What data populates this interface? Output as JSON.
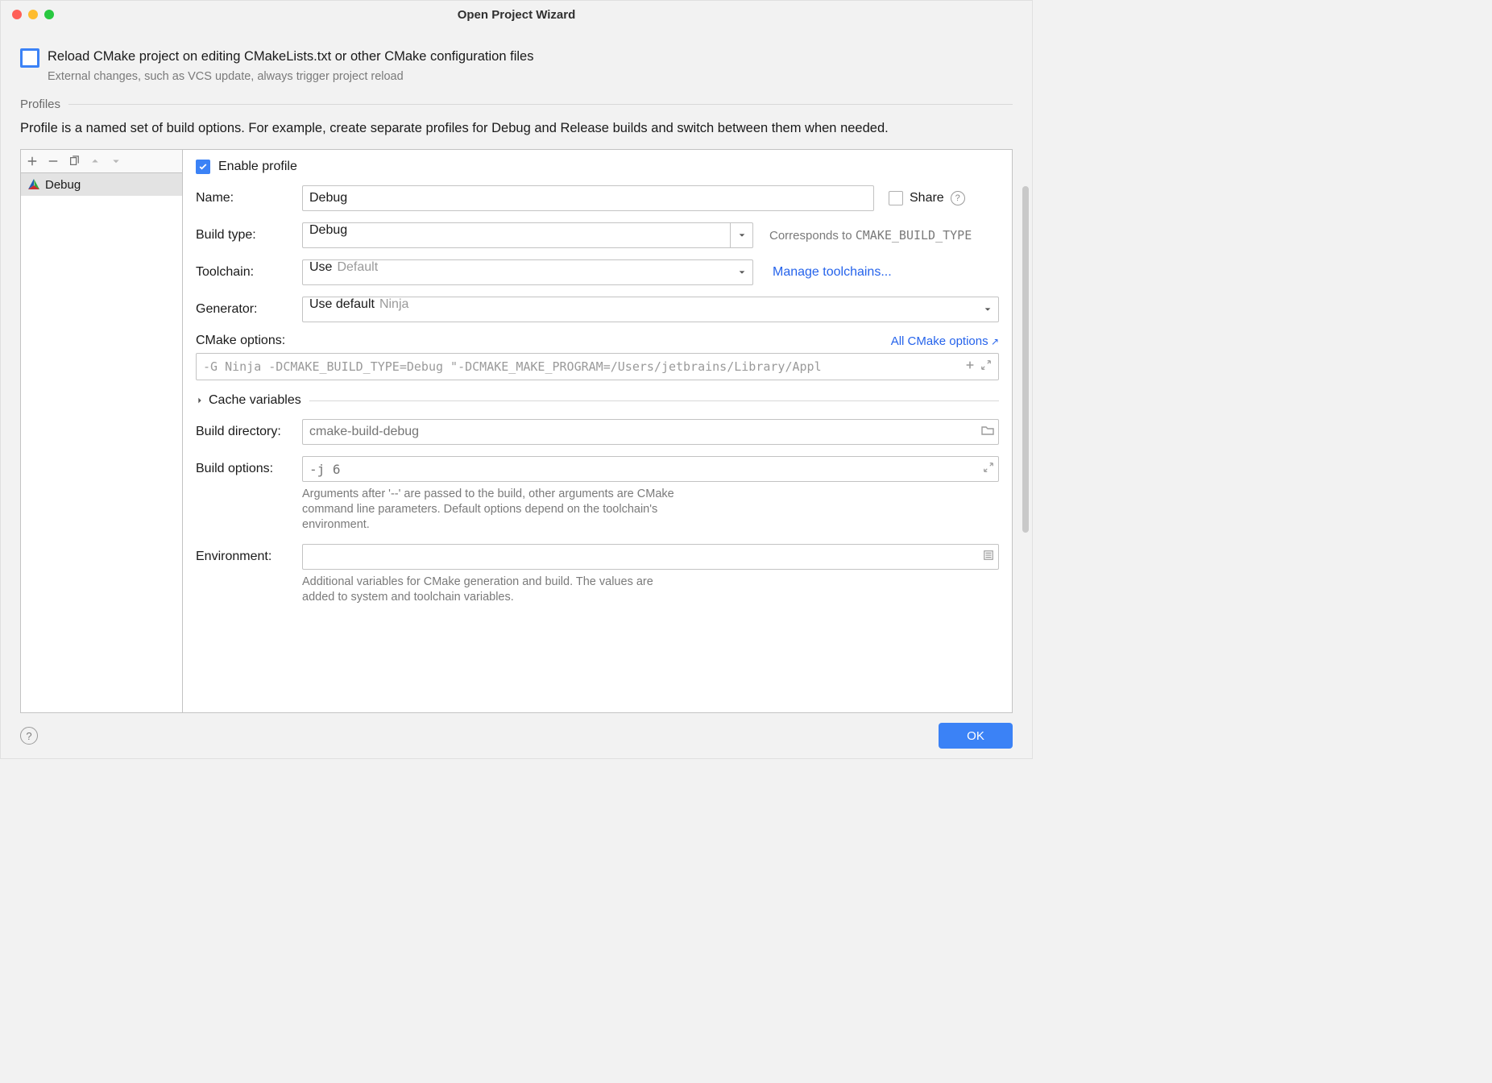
{
  "window": {
    "title": "Open Project Wizard"
  },
  "reload": {
    "label": "Reload CMake project on editing CMakeLists.txt or other CMake configuration files",
    "hint": "External changes, such as VCS update, always trigger project reload"
  },
  "profiles": {
    "section_label": "Profiles",
    "hint": "Profile is a named set of build options. For example, create separate profiles for Debug and Release builds and switch between them when needed.",
    "items": [
      {
        "name": "Debug"
      }
    ]
  },
  "form": {
    "enable_label": "Enable profile",
    "name_label": "Name:",
    "name_value": "Debug",
    "share_label": "Share",
    "build_type_label": "Build type:",
    "build_type_value": "Debug",
    "build_type_hint_pre": "Corresponds to ",
    "build_type_hint_code": "CMAKE_BUILD_TYPE",
    "toolchain_label": "Toolchain:",
    "toolchain_value_prefix": "Use",
    "toolchain_value_hint": "Default",
    "toolchain_link": "Manage toolchains...",
    "generator_label": "Generator:",
    "generator_value_prefix": "Use default",
    "generator_value_hint": "Ninja",
    "cmake_options_label": "CMake options:",
    "cmake_options_link": "All CMake options",
    "cmake_options_value": "-G Ninja -DCMAKE_BUILD_TYPE=Debug \"-DCMAKE_MAKE_PROGRAM=/Users/jetbrains/Library/Appl",
    "cache_vars_label": "Cache variables",
    "build_dir_label": "Build directory:",
    "build_dir_placeholder": "cmake-build-debug",
    "build_options_label": "Build options:",
    "build_options_placeholder": "-j 6",
    "build_options_hint": "Arguments after '--' are passed to the build, other arguments are CMake command line parameters. Default options depend on the toolchain's environment.",
    "environment_label": "Environment:",
    "environment_hint": "Additional variables for CMake generation and build. The values are added to system and toolchain variables."
  },
  "footer": {
    "ok": "OK"
  }
}
